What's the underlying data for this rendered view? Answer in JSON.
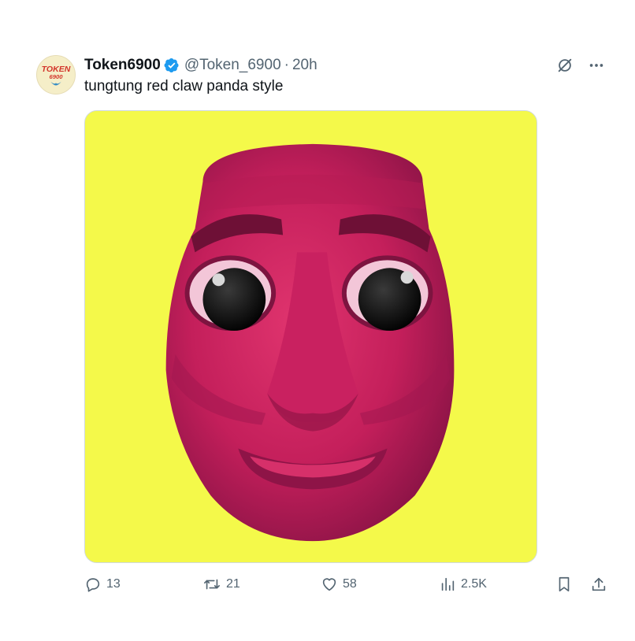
{
  "tweet": {
    "author_name": "Token6900",
    "handle": "@Token_6900",
    "separator": "·",
    "time": "20h",
    "text": "tungtung red claw panda style",
    "avatar_text": "TOKEN 6900",
    "image_subject": "pink-3d-face"
  },
  "stats": {
    "replies": "13",
    "reposts": "21",
    "likes": "58",
    "views": "2.5K"
  },
  "icons": {
    "verified": "verified-badge-icon",
    "grok": "grok-icon",
    "more": "more-icon",
    "reply": "reply-icon",
    "repost": "repost-icon",
    "like": "heart-icon",
    "views": "views-icon",
    "bookmark": "bookmark-icon",
    "share": "share-icon"
  },
  "colors": {
    "verified_blue": "#1d9bf0",
    "secondary_text": "#536471",
    "image_background": "#f4f94a",
    "face": "#c8245e"
  }
}
